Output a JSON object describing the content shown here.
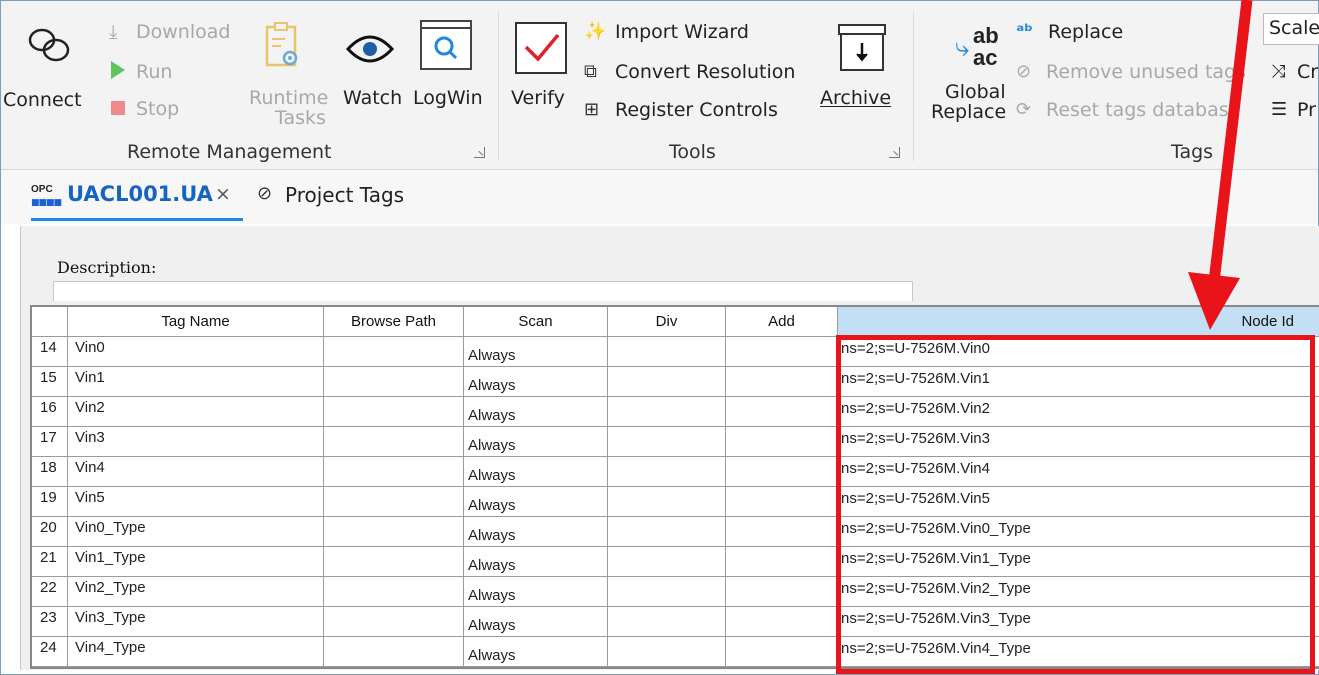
{
  "ribbon": {
    "connect_label": "Connect",
    "download_label": "Download",
    "run_label": "Run",
    "stop_label": "Stop",
    "runtime_tasks_line1": "Runtime",
    "runtime_tasks_line2": "Tasks",
    "watch_label": "Watch",
    "logwin_label": "LogWin",
    "remote_group_label": "Remote Management",
    "verify_label": "Verify",
    "import_wizard_label": "Import Wizard",
    "convert_resolution_label": "Convert Resolution",
    "register_controls_label": "Register Controls",
    "archive_label": "Archive",
    "tools_group_label": "Tools",
    "global_replace_line1": "Global",
    "global_replace_line2": "Replace",
    "replace_label": "Replace",
    "remove_unused_tags_label": "Remove unused tags",
    "reset_tags_database_label": "Reset tags database",
    "tags_group_label": "Tags",
    "scale_label": "Scale",
    "cr_label": "Cr",
    "pr_label": "Pr"
  },
  "tabs": {
    "active_tab_label": "UACL001.UA",
    "opc_badge": "OPC",
    "close_glyph": "×",
    "project_tags_label": "Project Tags"
  },
  "content": {
    "description_label": "Description:"
  },
  "table": {
    "columns": [
      "Tag Name",
      "Browse Path",
      "Scan",
      "Div",
      "Add",
      "Node Id"
    ],
    "rows": [
      {
        "num": "14",
        "tag": "Vin0",
        "scan": "Always",
        "node": "ns=2;s=U-7526M.Vin0"
      },
      {
        "num": "15",
        "tag": "Vin1",
        "scan": "Always",
        "node": "ns=2;s=U-7526M.Vin1"
      },
      {
        "num": "16",
        "tag": "Vin2",
        "scan": "Always",
        "node": "ns=2;s=U-7526M.Vin2"
      },
      {
        "num": "17",
        "tag": "Vin3",
        "scan": "Always",
        "node": "ns=2;s=U-7526M.Vin3"
      },
      {
        "num": "18",
        "tag": "Vin4",
        "scan": "Always",
        "node": "ns=2;s=U-7526M.Vin4"
      },
      {
        "num": "19",
        "tag": "Vin5",
        "scan": "Always",
        "node": "ns=2;s=U-7526M.Vin5"
      },
      {
        "num": "20",
        "tag": "Vin0_Type",
        "scan": "Always",
        "node": "ns=2;s=U-7526M.Vin0_Type"
      },
      {
        "num": "21",
        "tag": "Vin1_Type",
        "scan": "Always",
        "node": "ns=2;s=U-7526M.Vin1_Type"
      },
      {
        "num": "22",
        "tag": "Vin2_Type",
        "scan": "Always",
        "node": "ns=2;s=U-7526M.Vin2_Type"
      },
      {
        "num": "23",
        "tag": "Vin3_Type",
        "scan": "Always",
        "node": "ns=2;s=U-7526M.Vin3_Type"
      },
      {
        "num": "24",
        "tag": "Vin4_Type",
        "scan": "Always",
        "node": "ns=2;s=U-7526M.Vin4_Type"
      }
    ]
  },
  "colors": {
    "annotation_red": "#e8141a",
    "selected_header": "#c2dff5",
    "tab_accent": "#1e88e5"
  }
}
